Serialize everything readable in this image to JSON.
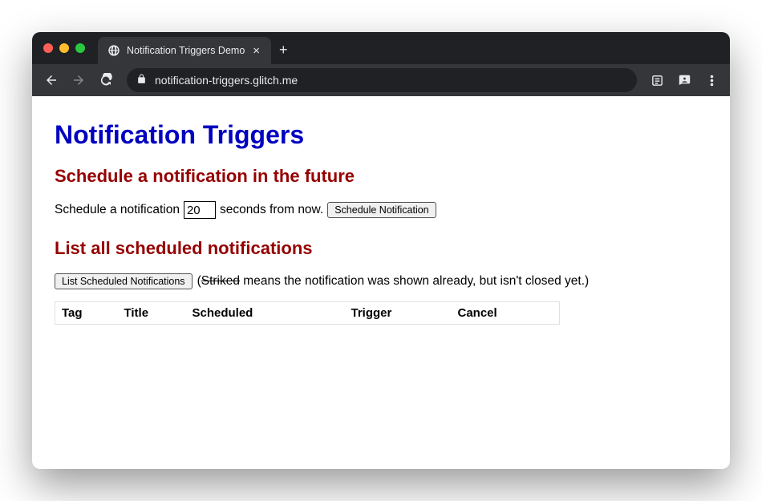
{
  "browser": {
    "tab_title": "Notification Triggers Demo",
    "url": "notification-triggers.glitch.me"
  },
  "page": {
    "heading": "Notification Triggers",
    "schedule": {
      "heading": "Schedule a notification in the future",
      "text_before": "Schedule a notification",
      "input_value": "20",
      "text_after": "seconds from now.",
      "button": "Schedule Notification"
    },
    "list": {
      "heading": "List all scheduled notifications",
      "button": "List Scheduled Notifications",
      "note_prefix": "(",
      "note_striked": "Striked",
      "note_rest": " means the notification was shown already, but isn't closed yet.)",
      "columns": {
        "tag": "Tag",
        "title": "Title",
        "scheduled": "Scheduled",
        "trigger": "Trigger",
        "cancel": "Cancel"
      }
    }
  }
}
